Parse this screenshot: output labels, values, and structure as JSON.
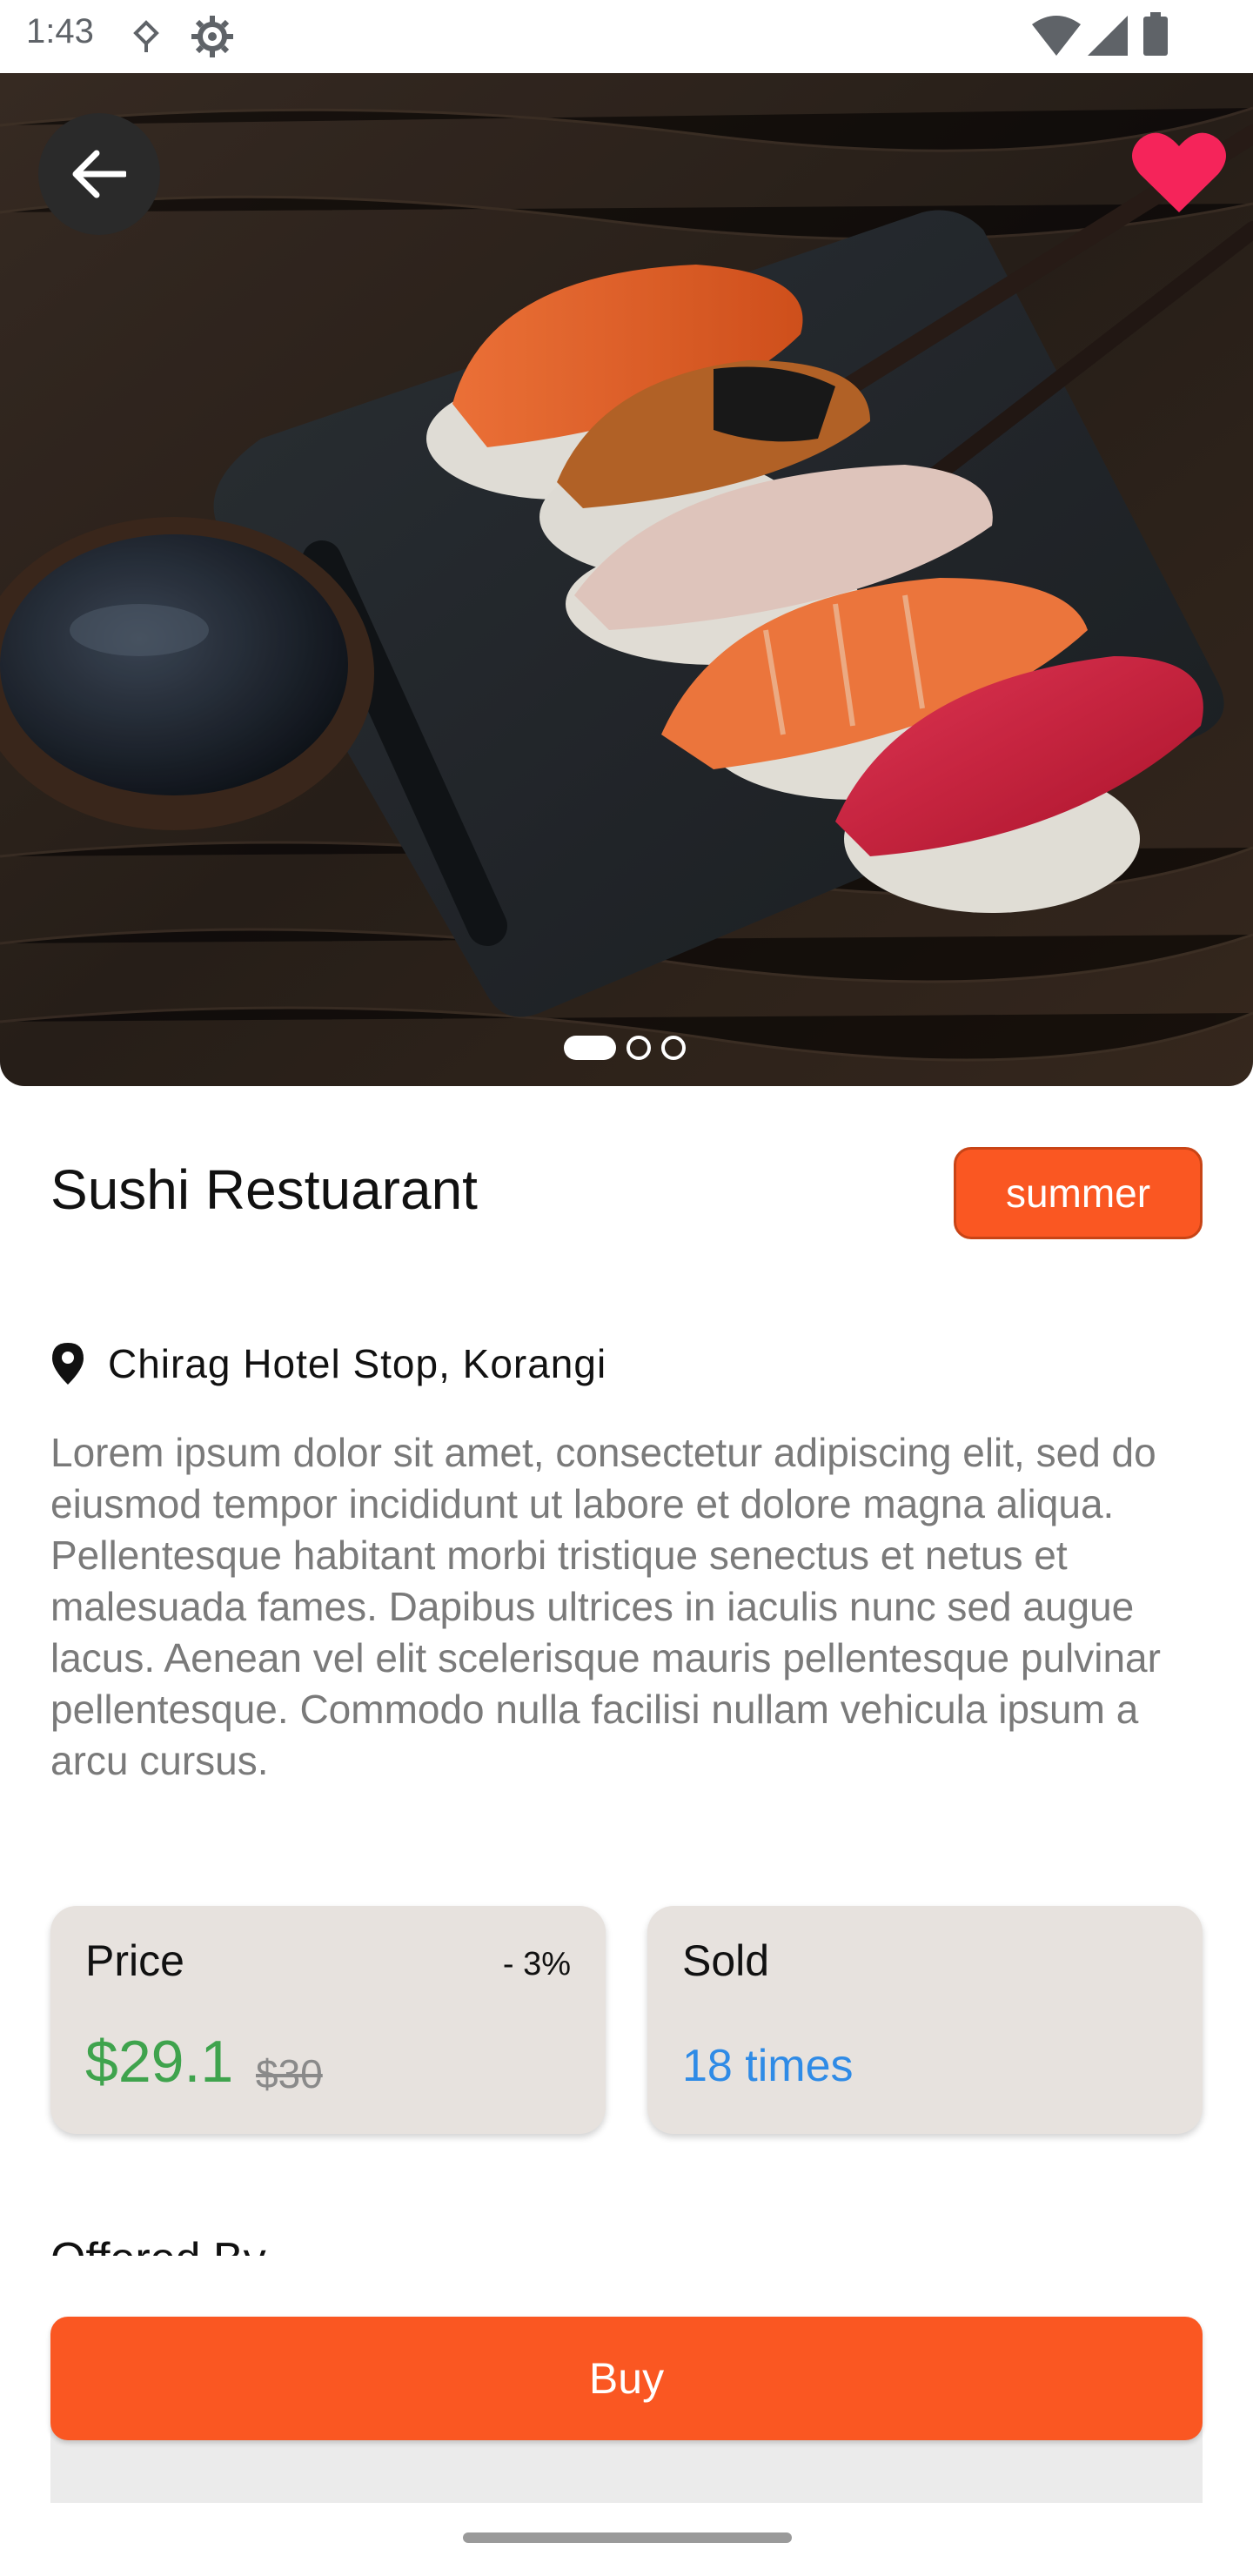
{
  "status_bar": {
    "time": "1:43"
  },
  "place": {
    "title": "Sushi Restuarant",
    "tag": "summer",
    "location": "Chirag Hotel Stop, Korangi",
    "description": "Lorem ipsum dolor sit amet, consectetur adipiscing elit, sed do eiusmod tempor incididunt ut labore et dolore magna aliqua. Pellentesque habitant morbi tristique senectus et netus et malesuada fames. Dapibus ultrices in iaculis nunc sed augue lacus. Aenean vel elit scelerisque mauris pellentesque pulvinar pellentesque. Commodo nulla facilisi nullam vehicula ipsum a arcu cursus."
  },
  "price_card": {
    "label": "Price",
    "discount": "- 3%",
    "new_price": "$29.1",
    "old_price": "$30"
  },
  "sold_card": {
    "label": "Sold",
    "value": "18 times"
  },
  "offered_by": "Offered By",
  "buy_button": "Buy",
  "carousel": {
    "pages": 3,
    "active_index": 0
  },
  "colors": {
    "accent": "#fa5722",
    "price_green": "#3fa34d",
    "sold_blue": "#2f8be6",
    "heart": "#f5245a",
    "card_bg": "#e7e2de"
  },
  "icons": [
    "back-arrow-icon",
    "heart-icon",
    "location-pin-icon",
    "wifi-icon",
    "signal-icon",
    "battery-icon",
    "vpn-key-icon",
    "settings-icon"
  ]
}
